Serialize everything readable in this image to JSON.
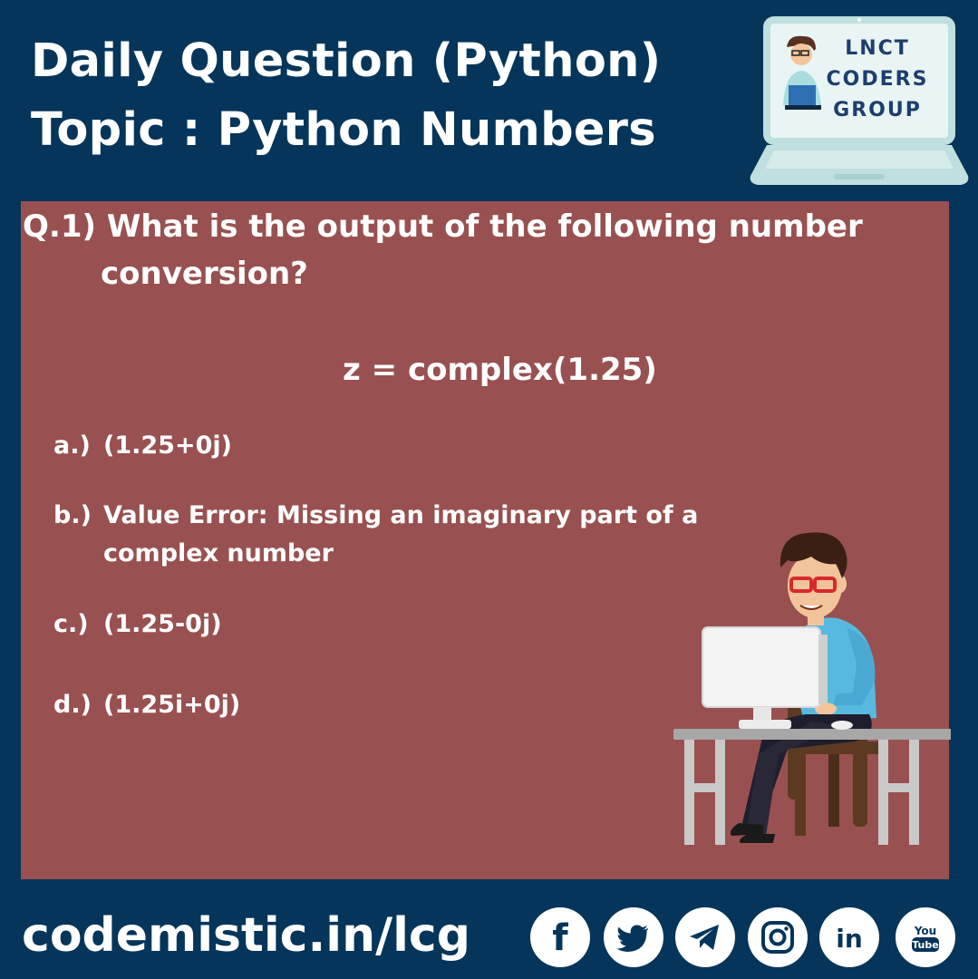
{
  "header": {
    "title_line1": "Daily Question (Python)",
    "title_line2": "Topic : Python Numbers"
  },
  "logo": {
    "line1": "LNCT",
    "line2": "CODERS",
    "line3": "GROUP"
  },
  "question": {
    "line1": "Q.1) What is the output of the following number",
    "line2": "conversion?",
    "code": "z = complex(1.25)"
  },
  "options": {
    "a_label": "a.)",
    "a_text": "(1.25+0j)",
    "b_label": "b.)",
    "b_text_line1": "Value Error: Missing an imaginary part of a",
    "b_text_line2": "complex number",
    "c_label": "c.)",
    "c_text": "(1.25-0j)",
    "d_label": "d.)",
    "d_text": "(1.25i+0j)"
  },
  "footer": {
    "website": "codemistic.in/lcg",
    "social_icons": [
      "facebook-icon",
      "twitter-icon",
      "telegram-icon",
      "instagram-icon",
      "linkedin-icon",
      "youtube-icon"
    ],
    "youtube_you": "You",
    "youtube_tube": "Tube",
    "linkedin_text": "in",
    "facebook_text": "f"
  },
  "colors": {
    "background": "#05355a",
    "panel": "#985150",
    "text": "#ffffff",
    "logo_screen": "#e9f5f5",
    "logo_text": "#1d3e6e"
  }
}
